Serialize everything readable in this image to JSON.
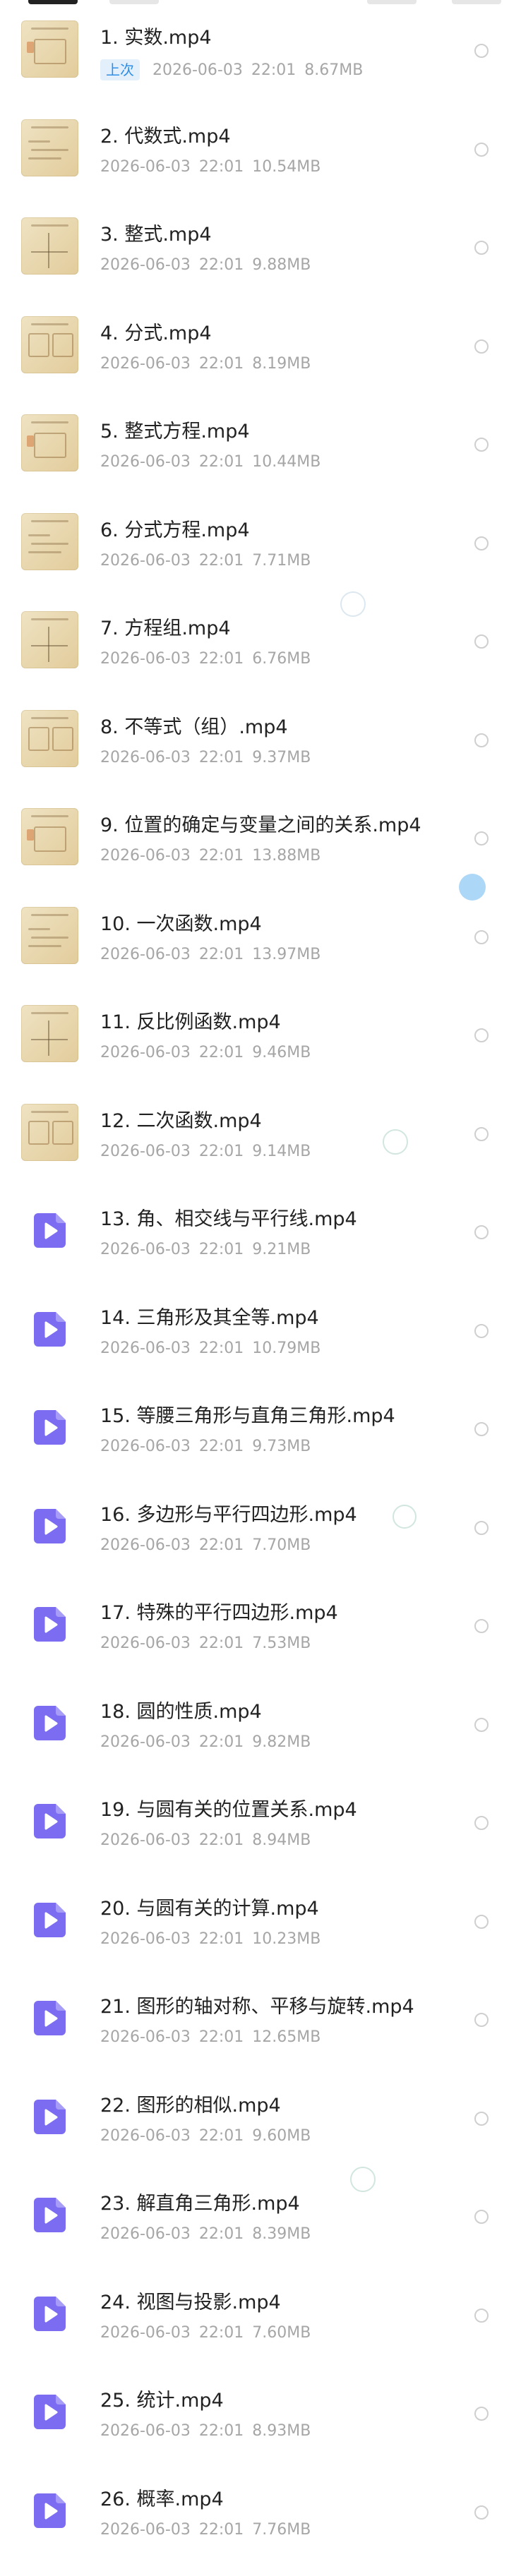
{
  "colors": {
    "accent": "#7b6cf2",
    "title_text": "#222222",
    "meta_text": "#a6a6a6",
    "last_badge_text": "#2f8fe6",
    "last_badge_bg": "#e3f0fc",
    "thumb_paper": "#e7d5ab"
  },
  "icons": {
    "video": "play-video-icon",
    "select": "radio-circle-icon"
  },
  "last_badge": "上次",
  "files": [
    {
      "name": "1. 实数.mp4",
      "date": "2026-06-03",
      "time": "22:01",
      "size": "8.67MB",
      "thumb": "image"
    },
    {
      "name": "2. 代数式.mp4",
      "date": "2026-06-03",
      "time": "22:01",
      "size": "10.54MB",
      "thumb": "image"
    },
    {
      "name": "3. 整式.mp4",
      "date": "2026-06-03",
      "time": "22:01",
      "size": "9.88MB",
      "thumb": "image"
    },
    {
      "name": "4. 分式.mp4",
      "date": "2026-06-03",
      "time": "22:01",
      "size": "8.19MB",
      "thumb": "image"
    },
    {
      "name": "5. 整式方程.mp4",
      "date": "2026-06-03",
      "time": "22:01",
      "size": "10.44MB",
      "thumb": "image"
    },
    {
      "name": "6. 分式方程.mp4",
      "date": "2026-06-03",
      "time": "22:01",
      "size": "7.71MB",
      "thumb": "image"
    },
    {
      "name": "7. 方程组.mp4",
      "date": "2026-06-03",
      "time": "22:01",
      "size": "6.76MB",
      "thumb": "image"
    },
    {
      "name": "8. 不等式（组）.mp4",
      "date": "2026-06-03",
      "time": "22:01",
      "size": "9.37MB",
      "thumb": "image"
    },
    {
      "name": "9. 位置的确定与变量之间的关系.mp4",
      "date": "2026-06-03",
      "time": "22:01",
      "size": "13.88MB",
      "thumb": "image"
    },
    {
      "name": "10. 一次函数.mp4",
      "date": "2026-06-03",
      "time": "22:01",
      "size": "13.97MB",
      "thumb": "image"
    },
    {
      "name": "11. 反比例函数.mp4",
      "date": "2026-06-03",
      "time": "22:01",
      "size": "9.46MB",
      "thumb": "image"
    },
    {
      "name": "12. 二次函数.mp4",
      "date": "2026-06-03",
      "time": "22:01",
      "size": "9.14MB",
      "thumb": "image"
    },
    {
      "name": "13. 角、相交线与平行线.mp4",
      "date": "2026-06-03",
      "time": "22:01",
      "size": "9.21MB",
      "thumb": "icon"
    },
    {
      "name": "14. 三角形及其全等.mp4",
      "date": "2026-06-03",
      "time": "22:01",
      "size": "10.79MB",
      "thumb": "icon"
    },
    {
      "name": "15. 等腰三角形与直角三角形.mp4",
      "date": "2026-06-03",
      "time": "22:01",
      "size": "9.73MB",
      "thumb": "icon"
    },
    {
      "name": "16. 多边形与平行四边形.mp4",
      "date": "2026-06-03",
      "time": "22:01",
      "size": "7.70MB",
      "thumb": "icon"
    },
    {
      "name": "17. 特殊的平行四边形.mp4",
      "date": "2026-06-03",
      "time": "22:01",
      "size": "7.53MB",
      "thumb": "icon"
    },
    {
      "name": "18. 圆的性质.mp4",
      "date": "2026-06-03",
      "time": "22:01",
      "size": "9.82MB",
      "thumb": "icon"
    },
    {
      "name": "19. 与圆有关的位置关系.mp4",
      "date": "2026-06-03",
      "time": "22:01",
      "size": "8.94MB",
      "thumb": "icon"
    },
    {
      "name": "20. 与圆有关的计算.mp4",
      "date": "2026-06-03",
      "time": "22:01",
      "size": "10.23MB",
      "thumb": "icon"
    },
    {
      "name": "21. 图形的轴对称、平移与旋转.mp4",
      "date": "2026-06-03",
      "time": "22:01",
      "size": "12.65MB",
      "thumb": "icon"
    },
    {
      "name": "22. 图形的相似.mp4",
      "date": "2026-06-03",
      "time": "22:01",
      "size": "9.60MB",
      "thumb": "icon"
    },
    {
      "name": "23. 解直角三角形.mp4",
      "date": "2026-06-03",
      "time": "22:01",
      "size": "8.39MB",
      "thumb": "icon"
    },
    {
      "name": "24. 视图与投影.mp4",
      "date": "2026-06-03",
      "time": "22:01",
      "size": "7.60MB",
      "thumb": "icon"
    },
    {
      "name": "25. 统计.mp4",
      "date": "2026-06-03",
      "time": "22:01",
      "size": "8.93MB",
      "thumb": "icon"
    },
    {
      "name": "26. 概率.mp4",
      "date": "2026-06-03",
      "time": "22:01",
      "size": "7.76MB",
      "thumb": "icon"
    }
  ]
}
